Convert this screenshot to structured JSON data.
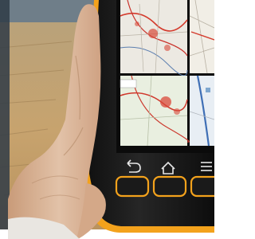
{
  "photo": {
    "subject": "hand-holding-rugged-tablet",
    "colors": {
      "sky": "#6f7e89",
      "field": "#c9a873",
      "skin": "#d8b59b",
      "device_body": "#151515",
      "bumper": "#f3a21c",
      "screen_bezel": "#0b0b0b"
    },
    "screen": {
      "panes": [
        {
          "icon": "map-pane-top-left-icon"
        },
        {
          "icon": "map-pane-top-right-icon"
        },
        {
          "icon": "map-pane-bottom-left-icon"
        },
        {
          "icon": "map-pane-bottom-right-icon"
        }
      ]
    },
    "nav_keys": [
      {
        "icon": "back-arrow-icon"
      },
      {
        "icon": "home-icon"
      },
      {
        "icon": "menu-icon"
      }
    ]
  }
}
